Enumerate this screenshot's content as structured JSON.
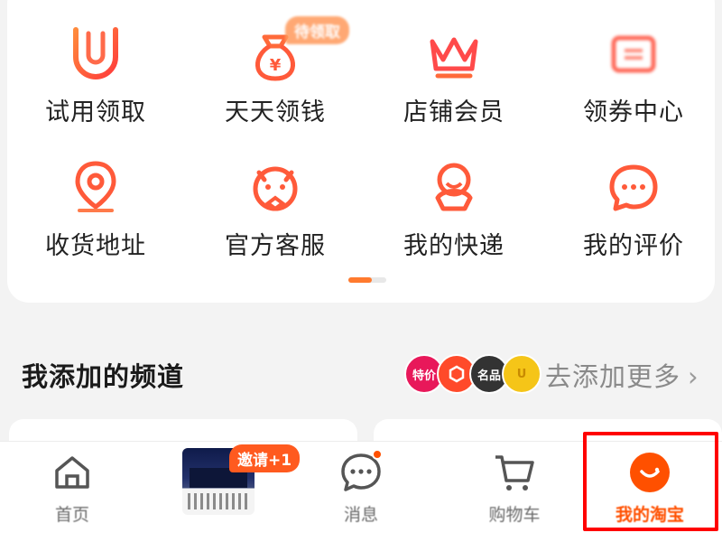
{
  "services": {
    "badge": "待领取",
    "items": [
      {
        "label": "试用领取",
        "icon": "trial-u-icon"
      },
      {
        "label": "天天领钱",
        "icon": "money-bag-icon"
      },
      {
        "label": "店铺会员",
        "icon": "crown-icon"
      },
      {
        "label": "领券中心",
        "icon": "coupon-icon"
      },
      {
        "label": "收货地址",
        "icon": "location-pin-icon"
      },
      {
        "label": "官方客服",
        "icon": "customer-service-icon"
      },
      {
        "label": "我的快递",
        "icon": "courier-icon"
      },
      {
        "label": "我的评价",
        "icon": "chat-bubble-icon"
      }
    ]
  },
  "channels": {
    "title": "我添加的频道",
    "icons": [
      {
        "label": "特价",
        "color": "#e8185a"
      },
      {
        "label": "",
        "color": "#ff4a2a"
      },
      {
        "label": "名品",
        "color": "#333333"
      },
      {
        "label": "U",
        "color": "#f5c518"
      }
    ],
    "add_more": "去添加更多",
    "chevron": "›"
  },
  "tabbar": {
    "invite_badge": "邀请+1",
    "tabs": [
      {
        "label": "首页"
      },
      {
        "label": ""
      },
      {
        "label": "消息"
      },
      {
        "label": "购物车"
      },
      {
        "label": "我的淘宝"
      }
    ]
  },
  "colors": {
    "accent": "#ff5000",
    "icon_gradient_start": "#ff7a2e",
    "icon_gradient_end": "#ff3b3b",
    "highlight": "#ff0000"
  }
}
